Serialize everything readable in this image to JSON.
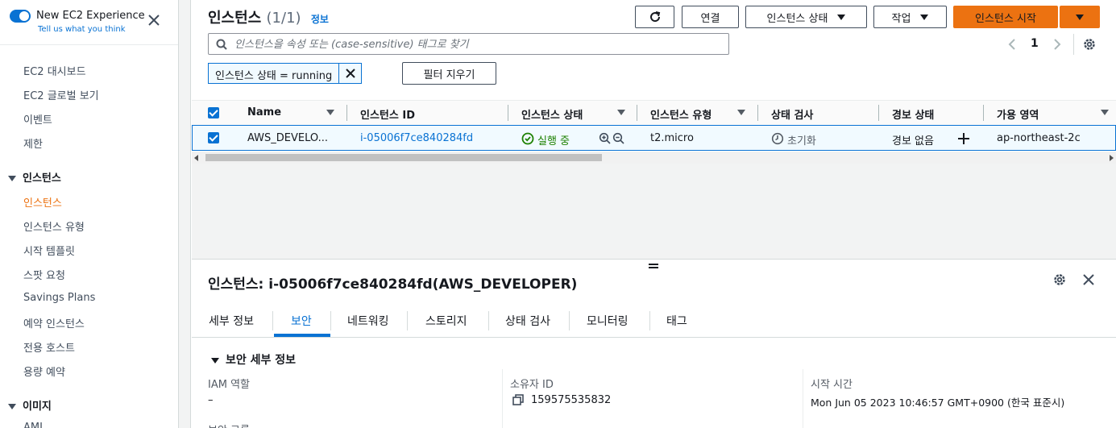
{
  "sidebar": {
    "new_experience_title": "New EC2 Experience",
    "new_experience_sub": "Tell us what you think",
    "items_top": [
      "EC2 대시보드",
      "EC2 글로벌 보기",
      "이벤트",
      "제한"
    ],
    "section_instances": "인스턴스",
    "items_instances": [
      "인스턴스",
      "인스턴스 유형",
      "시작 템플릿",
      "스팟 요청",
      "Savings Plans",
      "예약 인스턴스",
      "전용 호스트",
      "용량 예약"
    ],
    "section_images": "이미지",
    "item_ami": "AMI"
  },
  "header": {
    "title": "인스턴스",
    "count": "(1/1)",
    "info": "정보",
    "connect_label": "연결",
    "instance_state_label": "인스턴스 상태",
    "actions_label": "작업",
    "launch_label": "인스턴스 시작"
  },
  "search": {
    "placeholder": "인스턴스을 속성 또는 (case-sensitive) 태그로 찾기"
  },
  "pager": {
    "current_page": "1"
  },
  "filter": {
    "token": "인스턴스 상태 = running",
    "clear_label": "필터 지우기"
  },
  "table": {
    "columns": [
      "Name",
      "인스턴스 ID",
      "인스턴스 상태",
      "인스턴스 유형",
      "상태 검사",
      "경보 상태",
      "가용 영역"
    ],
    "rows": [
      {
        "name": "AWS_DEVELO...",
        "instance_id": "i-05006f7ce840284fd",
        "state": "실행 중",
        "type": "t2.micro",
        "status_check": "초기화",
        "alarm": "경보 없음",
        "az": "ap-northeast-2c"
      }
    ]
  },
  "detail": {
    "title": "인스턴스: i-05006f7ce840284fd(AWS_DEVELOPER)",
    "tabs": [
      "세부 정보",
      "보안",
      "네트워킹",
      "스토리지",
      "상태 검사",
      "모니터링",
      "태그"
    ],
    "section": "보안 세부 정보",
    "iam_label": "IAM 역할",
    "iam_value": "–",
    "owner_label": "소유자 ID",
    "owner_value": "159575535832",
    "launch_time_label": "시작 시간",
    "launch_time_value": "Mon Jun 05 2023 10:46:57 GMT+0900 (한국 표준시)",
    "security_groups_label": "보안 그룹"
  },
  "colors": {
    "accent": "#0972d3",
    "primary": "#ec7211",
    "success": "#1d8102"
  }
}
